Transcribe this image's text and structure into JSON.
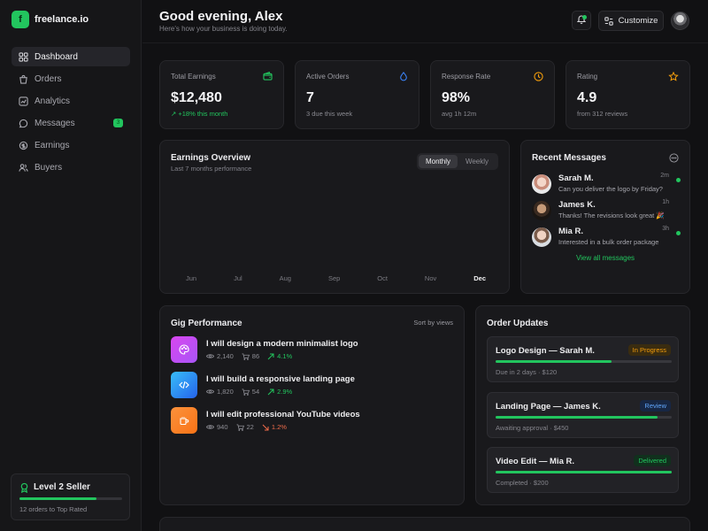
{
  "brand": {
    "logo_letter": "f",
    "name": "freelance.io",
    "accent": "#22c55e"
  },
  "sidebar": {
    "items": [
      {
        "label": "Dashboard",
        "icon": "grid-icon",
        "active": true
      },
      {
        "label": "Orders",
        "icon": "bag-icon"
      },
      {
        "label": "Analytics",
        "icon": "trend-icon"
      },
      {
        "label": "Messages",
        "icon": "chat-icon",
        "badge": "3"
      },
      {
        "label": "Earnings",
        "icon": "coins-icon"
      },
      {
        "label": "Buyers",
        "icon": "users-icon"
      }
    ],
    "level": {
      "title": "Level 2 Seller",
      "subtitle": "12 orders to Top Rated",
      "progress": 0.75
    }
  },
  "header": {
    "greeting": "Good evening, Alex",
    "subtitle": "Here's how your business is doing today.",
    "customize_label": "Customize"
  },
  "stats": [
    {
      "label": "Total Earnings",
      "value": "$12,480",
      "sub": "↗ +18% this month",
      "sub_color": "green",
      "icon": "wallet-icon",
      "icon_color": "#22c55e"
    },
    {
      "label": "Active Orders",
      "value": "7",
      "sub": "3 due this week",
      "icon": "drop-icon",
      "icon_color": "#3b82f6"
    },
    {
      "label": "Response Rate",
      "value": "98%",
      "sub": "avg 1h 12m",
      "icon": "clock-icon",
      "icon_color": "#f59e0b"
    },
    {
      "label": "Rating",
      "value": "4.9",
      "sub": "from 312 reviews",
      "icon": "star-icon",
      "icon_color": "#f59e0b"
    }
  ],
  "earnings": {
    "title": "Earnings Overview",
    "subtitle": "Last 7 months performance",
    "toggle": [
      "Monthly",
      "Weekly"
    ],
    "months": [
      "Jun",
      "Jul",
      "Aug",
      "Sep",
      "Oct",
      "Nov",
      "Dec"
    ]
  },
  "messages": {
    "title": "Recent Messages",
    "items": [
      {
        "name": "Sarah M.",
        "time": "2m",
        "text": "Can you deliver the logo by Friday?",
        "unread": true
      },
      {
        "name": "James K.",
        "time": "1h",
        "text": "Thanks! The revisions look great 🎉",
        "unread": false
      },
      {
        "name": "Mia R.",
        "time": "3h",
        "text": "Interested in a bulk order package",
        "unread": true
      }
    ],
    "view_all": "View all messages"
  },
  "gigs": {
    "title": "Gig Performance",
    "sort_label": "Sort by views",
    "items": [
      {
        "title": "I will design a modern minimalist logo",
        "views": "2,140",
        "orders": "86",
        "change": "4.1%",
        "trend": "up",
        "icon": "palette-icon"
      },
      {
        "title": "I will build a responsive landing page",
        "views": "1,820",
        "orders": "54",
        "change": "2.9%",
        "trend": "up",
        "icon": "code-icon"
      },
      {
        "title": "I will edit professional YouTube videos",
        "views": "940",
        "orders": "22",
        "change": "1.2%",
        "trend": "down",
        "icon": "video-icon"
      }
    ]
  },
  "orders": {
    "title": "Order Updates",
    "items": [
      {
        "title": "Logo Design — Sarah M.",
        "status": "In Progress",
        "status_color": "#f59e0b",
        "progress": 0.66,
        "sub": "Due in 2 days · $120"
      },
      {
        "title": "Landing Page — James K.",
        "status": "Review",
        "status_color": "#3b82f6",
        "progress": 0.92,
        "sub": "Awaiting approval · $450"
      },
      {
        "title": "Video Edit — Mia R.",
        "status": "Delivered",
        "status_color": "#22c55e",
        "progress": 1.0,
        "sub": "Completed · $200"
      }
    ]
  }
}
